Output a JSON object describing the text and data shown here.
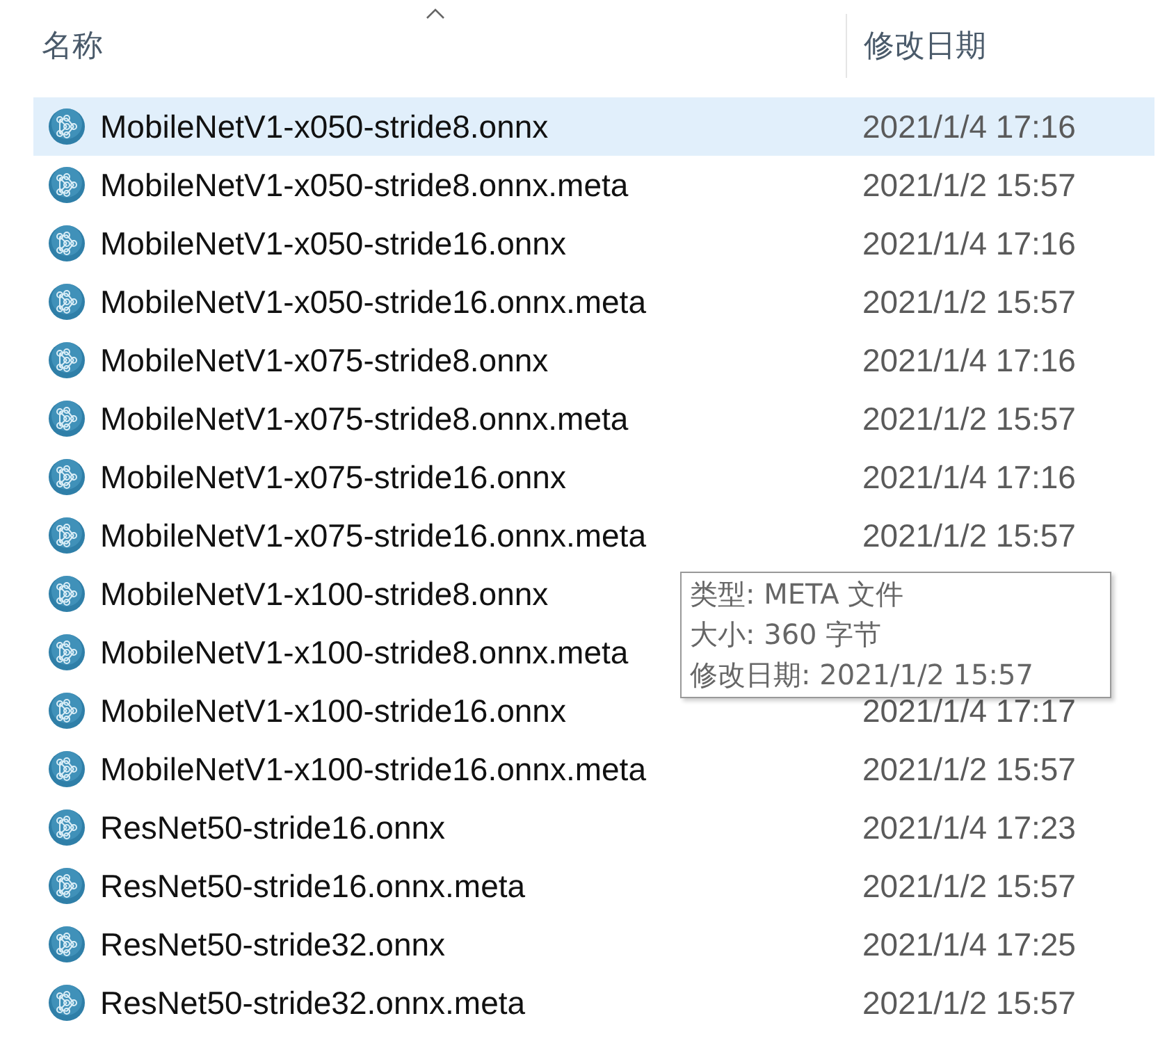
{
  "columns": [
    {
      "label": "名称",
      "sorted": true
    },
    {
      "label": "修改日期",
      "sorted": false
    }
  ],
  "files": [
    {
      "name": "MobileNetV1-x050-stride8.onnx",
      "modified": "2021/1/4 17:16",
      "selected": true
    },
    {
      "name": "MobileNetV1-x050-stride8.onnx.meta",
      "modified": "2021/1/2 15:57",
      "selected": false
    },
    {
      "name": "MobileNetV1-x050-stride16.onnx",
      "modified": "2021/1/4 17:16",
      "selected": false
    },
    {
      "name": "MobileNetV1-x050-stride16.onnx.meta",
      "modified": "2021/1/2 15:57",
      "selected": false
    },
    {
      "name": "MobileNetV1-x075-stride8.onnx",
      "modified": "2021/1/4 17:16",
      "selected": false
    },
    {
      "name": "MobileNetV1-x075-stride8.onnx.meta",
      "modified": "2021/1/2 15:57",
      "selected": false
    },
    {
      "name": "MobileNetV1-x075-stride16.onnx",
      "modified": "2021/1/4 17:16",
      "selected": false
    },
    {
      "name": "MobileNetV1-x075-stride16.onnx.meta",
      "modified": "2021/1/2 15:57",
      "selected": false
    },
    {
      "name": "MobileNetV1-x100-stride8.onnx",
      "selected": false
    },
    {
      "name": "MobileNetV1-x100-stride8.onnx.meta",
      "selected": false
    },
    {
      "name": "MobileNetV1-x100-stride16.onnx",
      "modified": "2021/1/4 17:17",
      "selected": false
    },
    {
      "name": "MobileNetV1-x100-stride16.onnx.meta",
      "modified": "2021/1/2 15:57",
      "selected": false
    },
    {
      "name": "ResNet50-stride16.onnx",
      "modified": "2021/1/4 17:23",
      "selected": false
    },
    {
      "name": "ResNet50-stride16.onnx.meta",
      "modified": "2021/1/2 15:57",
      "selected": false
    },
    {
      "name": "ResNet50-stride32.onnx",
      "modified": "2021/1/4 17:25",
      "selected": false
    },
    {
      "name": "ResNet50-stride32.onnx.meta",
      "modified": "2021/1/2 15:57",
      "selected": false
    }
  ],
  "tooltip": {
    "lines": [
      "类型: META 文件",
      "大小: 360 字节",
      "修改日期: 2021/1/2 15:57"
    ]
  }
}
